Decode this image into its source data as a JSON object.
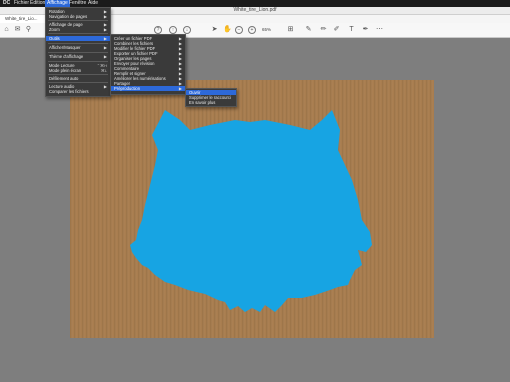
{
  "menubar": {
    "app": "DC",
    "items": [
      "Fichier",
      "Edition",
      "Affichage",
      "Fenêtre",
      "Aide"
    ]
  },
  "window": {
    "title": "White_tire_Lion.pdf"
  },
  "tab": {
    "label": "White_tire_Lio..."
  },
  "toolbar": {
    "zoom": "65%"
  },
  "menu_affichage": {
    "items": [
      {
        "label": "Rotation",
        "arrow": "▶"
      },
      {
        "label": "Navigation de pages",
        "arrow": "▶"
      },
      {
        "label": "Affichage de page",
        "arrow": "▶"
      },
      {
        "label": "Zoom",
        "arrow": "▶"
      },
      {
        "label": "Outils",
        "arrow": "▶"
      },
      {
        "label": "Afficher/Masquer",
        "arrow": "▶"
      },
      {
        "label": "Thème d'affichage",
        "arrow": "▶"
      },
      {
        "label": "Mode Lecture",
        "kbd": "⌃⌘H"
      },
      {
        "label": "Mode plein écran",
        "kbd": "⌘L"
      },
      {
        "label": "Défilement auto"
      },
      {
        "label": "Lecture audio",
        "arrow": "▶"
      },
      {
        "label": "Comparer les fichiers"
      }
    ]
  },
  "menu_outils": {
    "items": [
      {
        "label": "Créer un fichier PDF",
        "arrow": "▶"
      },
      {
        "label": "Combiner les fichiers",
        "arrow": "▶"
      },
      {
        "label": "Modifier le fichier PDF",
        "arrow": "▶"
      },
      {
        "label": "Exporter un fichier PDF",
        "arrow": "▶"
      },
      {
        "label": "Organiser les pages",
        "arrow": "▶"
      },
      {
        "label": "Envoyer pour révision",
        "arrow": "▶"
      },
      {
        "label": "Commentaire",
        "arrow": "▶"
      },
      {
        "label": "Remplir et signer",
        "arrow": "▶"
      },
      {
        "label": "Améliorer les numérisations",
        "arrow": "▶"
      },
      {
        "label": "Partager",
        "arrow": "▶"
      },
      {
        "label": "Préproduction",
        "arrow": "▶"
      }
    ]
  },
  "menu_preproduction": {
    "items": [
      {
        "label": "Ouvrir"
      },
      {
        "label": "Supprimer le raccourci"
      },
      {
        "label": "En savoir plus"
      }
    ]
  },
  "colors": {
    "accent": "#2d69d9",
    "tiger": "#17a4e3",
    "cardboard": "#a87d4f"
  }
}
